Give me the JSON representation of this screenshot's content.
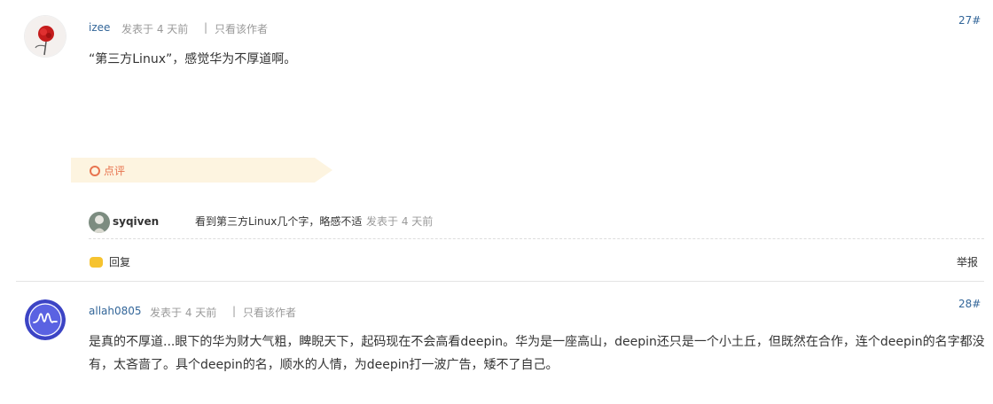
{
  "post27": {
    "author": "izee",
    "posted": "发表于 4 天前",
    "separator": "|",
    "only_author": "只看该作者",
    "floor": "27#",
    "content": "“第三方Linux”，感觉华为不厚道啊。",
    "comment_header": "点评",
    "comment": {
      "user": "syqiven",
      "text": "看到第三方Linux几个字，略感不适",
      "posted": "发表于 4 天前"
    },
    "reply_label": "回复",
    "report_label": "举报"
  },
  "post28": {
    "author": "allah0805",
    "posted": "发表于 4 天前",
    "separator": "|",
    "only_author": "只看该作者",
    "floor": "28#",
    "content_line1": "是真的不厚道...眼下的华为财大气粗，睥睨天下，起码现在不会高看deepin。华为是一座高山，deepin还只是一个小土丘，但既然在合作，连个deepin的名字都没",
    "content_line2": "有，太吝啬了。具个deepin的名，顺水的人情，为deepin打一波广告，矮不了自己。"
  }
}
